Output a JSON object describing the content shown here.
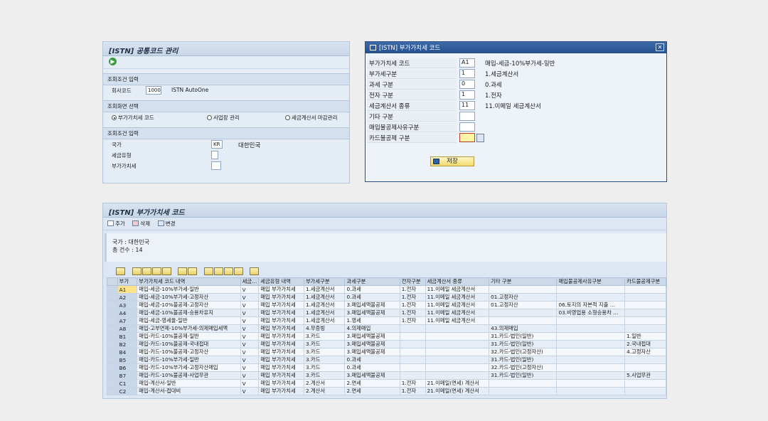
{
  "panel1": {
    "title": "[ISTN] 공통코드 관리",
    "sec1_title": "조회조건 입력",
    "company_label": "회사코드",
    "company_code": "1000",
    "company_name": "ISTN AutoOne",
    "sec2_title": "조회화면 선택",
    "radio1": "부가가치세 코드",
    "radio2": "사업장 관리",
    "radio3": "세금계산서 마감관리",
    "sec3_title": "조회조건 입력",
    "country_label": "국가",
    "country_code": "KR",
    "country_name": "대한민국",
    "taxtype_label": "세금유형",
    "vat_label": "부가가치세"
  },
  "dialog": {
    "title": "[ISTN] 부가가치세 코드",
    "close": "✕",
    "rows": [
      {
        "label": "부가가치세 코드",
        "value": "A1",
        "text": "매입-세금-10%부가세-일반"
      },
      {
        "label": "부가세구분",
        "value": "1",
        "text": "1.세금계산서"
      },
      {
        "label": "과세 구분",
        "value": "0",
        "text": "0.과세"
      },
      {
        "label": "전자 구분",
        "value": "1",
        "text": "1.전자"
      },
      {
        "label": "세금계산서 종류",
        "value": "11",
        "text": "11.이메일 세금계산서"
      },
      {
        "label": "기타 구분",
        "value": "",
        "text": ""
      },
      {
        "label": "매입불공제사유구분",
        "value": "",
        "text": ""
      },
      {
        "label": "카드불공제 구분",
        "value": "",
        "text": ""
      }
    ],
    "save_label": "저장"
  },
  "panel3": {
    "title": "[ISTN] 부가가치세 코드",
    "btn_add": "추가",
    "btn_delete": "삭제",
    "btn_change": "변경",
    "country_line": "국가 : 대한민국",
    "count_line": "총 건수 : 14",
    "columns": [
      "부가",
      "부가가치세 코드 내역",
      "세금…",
      "세금유형 내역",
      "부가세구분",
      "과세구분",
      "전자구분",
      "세금계산서 종류",
      "기타 구분",
      "매입불공제사유구분",
      "카드불공제구분"
    ],
    "rows": [
      [
        "A1",
        "매입-세금-10%부가세-일반",
        "V",
        "매입 부가가치세",
        "1.세금계산서",
        "0.과세",
        "1.전자",
        "11.이메일 세금계산서",
        "",
        "",
        ""
      ],
      [
        "A2",
        "매입-세금-10%부가세-고정자산",
        "V",
        "매입 부가가치세",
        "1.세금계산서",
        "0.과세",
        "1.전자",
        "11.이메일 세금계산서",
        "01.고정자산",
        "",
        ""
      ],
      [
        "A3",
        "매입-세금-10%불공제-고정자산",
        "V",
        "매입 부가가치세",
        "1.세금계산서",
        "3.매입세액불공제",
        "1.전자",
        "11.이메일 세금계산서",
        "01.고정자산",
        "06.토지의 자본적 지출 …",
        ""
      ],
      [
        "A4",
        "매입-세금-10%불공제-승용차유지",
        "V",
        "매입 부가가치세",
        "1.세금계산서",
        "3.매입세액불공제",
        "1.전자",
        "11.이메일 세금계산서",
        "",
        "03.비영업용 소형승용차 …",
        ""
      ],
      [
        "A7",
        "매입-세금-영세율-일반",
        "V",
        "매입 부가가치세",
        "1.세금계산서",
        "1.영세",
        "1.전자",
        "11.이메일 세금계산서",
        "",
        "",
        ""
      ],
      [
        "A8",
        "매입-고부면제-10%부가세-의제매입세액",
        "V",
        "매입 부가가치세",
        "4.무증빙",
        "4.의제매입",
        "",
        "",
        "43.의제매입",
        "",
        ""
      ],
      [
        "B1",
        "매입-카드-10%불공제-일반",
        "V",
        "매입 부가가치세",
        "3.카드",
        "3.매입세액불공제",
        "",
        "",
        "31.카드-법인(일반)",
        "",
        "1.일반"
      ],
      [
        "B2",
        "매입-카드-10%불공제-국내접대",
        "V",
        "매입 부가가치세",
        "3.카드",
        "3.매입세액불공제",
        "",
        "",
        "31.카드-법인(일반)",
        "",
        "2.국내접대"
      ],
      [
        "B4",
        "매입-카드-10%불공제-고정자산",
        "V",
        "매입 부가가치세",
        "3.카드",
        "3.매입세액불공제",
        "",
        "",
        "32.카드-법인(고정자산)",
        "",
        "4.고정자산"
      ],
      [
        "B5",
        "매입-카드-10%부가세-일반",
        "V",
        "매입 부가가치세",
        "3.카드",
        "0.과세",
        "",
        "",
        "31.카드-법인(일반)",
        "",
        ""
      ],
      [
        "B6",
        "매입-카드-10%부가세-고정자산매입",
        "V",
        "매입 부가가치세",
        "3.카드",
        "0.과세",
        "",
        "",
        "32.카드-법인(고정자산)",
        "",
        ""
      ],
      [
        "B7",
        "매입-카드-10%불공제-사업무관",
        "V",
        "매입 부가가치세",
        "3.카드",
        "3.매입세액불공제",
        "",
        "",
        "31.카드-법인(일반)",
        "",
        "5.사업무관"
      ],
      [
        "C1",
        "매입-계산서-일반",
        "V",
        "매입 부가가치세",
        "2.계산서",
        "2.면세",
        "1.전자",
        "21.이메일(면세) 계산서",
        "",
        "",
        ""
      ],
      [
        "C2",
        "매입-계산서-접대비",
        "V",
        "매입 부가가치세",
        "2.계산서",
        "2.면세",
        "1.전자",
        "21.이메일(면세) 계산서",
        "",
        "",
        ""
      ]
    ]
  }
}
